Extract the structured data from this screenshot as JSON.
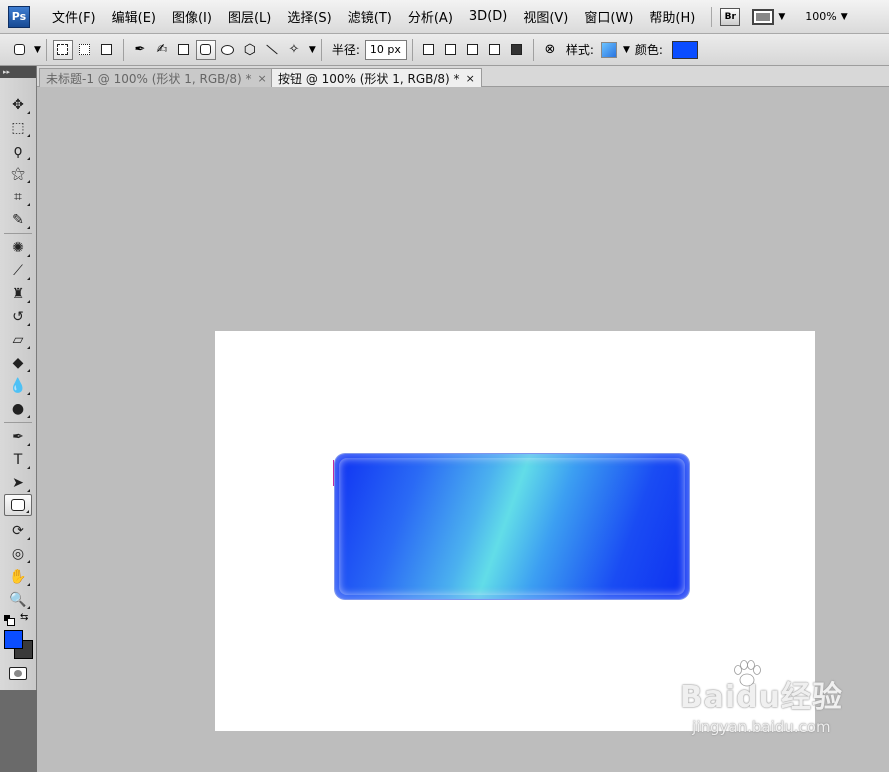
{
  "app": {
    "logo": "Ps",
    "bridge_label": "Br",
    "zoom": "100%"
  },
  "menu": [
    {
      "label": "文件(F)"
    },
    {
      "label": "编辑(E)"
    },
    {
      "label": "图像(I)"
    },
    {
      "label": "图层(L)"
    },
    {
      "label": "选择(S)"
    },
    {
      "label": "滤镜(T)"
    },
    {
      "label": "分析(A)"
    },
    {
      "label": "3D(D)"
    },
    {
      "label": "视图(V)"
    },
    {
      "label": "窗口(W)"
    },
    {
      "label": "帮助(H)"
    }
  ],
  "options": {
    "radius_label": "半径:",
    "radius_value": "10 px",
    "style_label": "样式:",
    "color_label": "颜色:",
    "color_value": "#0a4dff"
  },
  "tabs": [
    {
      "title": "未标题-1 @ 100% (形状 1, RGB/8) *",
      "active": false
    },
    {
      "title": "按钮 @ 100% (形状 1, RGB/8) *",
      "active": true
    }
  ],
  "tab_close_glyph": "×",
  "colors": {
    "foreground": "#0a4dff",
    "background": "#3a3a3a",
    "workspace": "#bdbdbd"
  },
  "watermark": {
    "logo": "Baidu经验",
    "url": "jingyan.baidu.com"
  }
}
